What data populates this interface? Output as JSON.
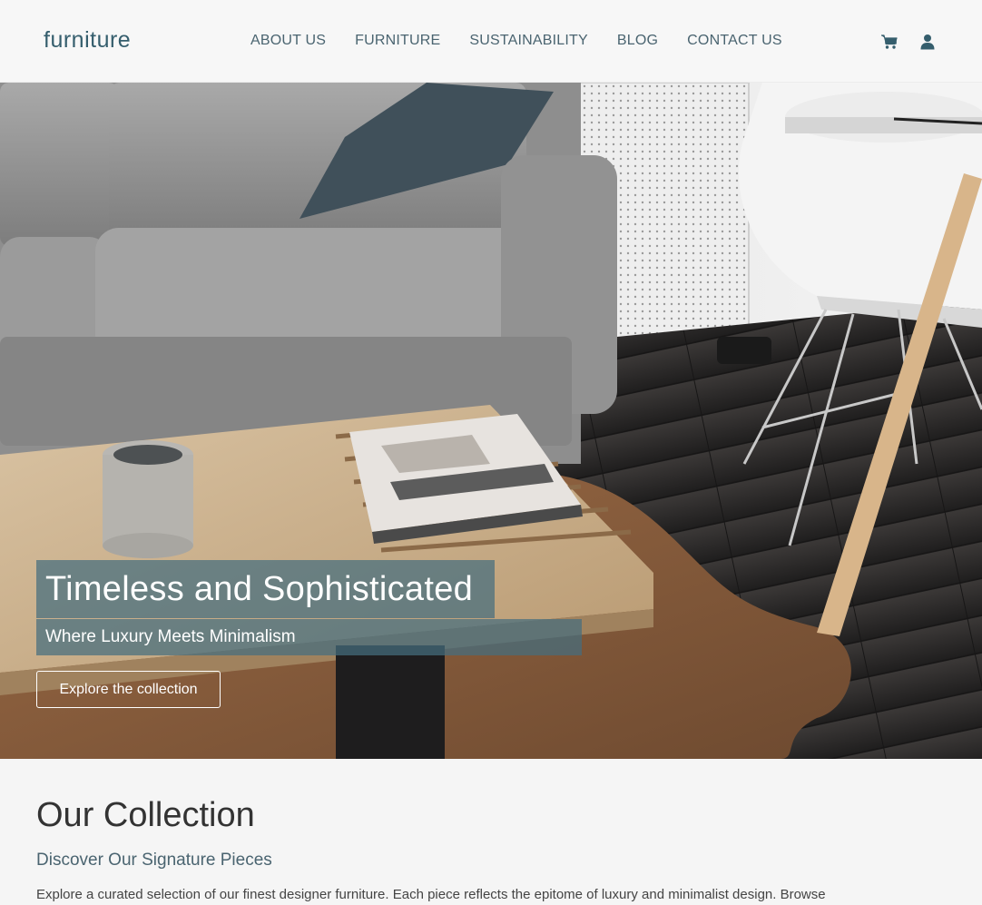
{
  "brand": {
    "logo_text": "furniture"
  },
  "nav": {
    "items": [
      {
        "label": "ABOUT US"
      },
      {
        "label": "FURNITURE"
      },
      {
        "label": "SUSTAINABILITY"
      },
      {
        "label": "BLOG"
      },
      {
        "label": "CONTACT US"
      }
    ]
  },
  "header_icons": {
    "cart": "cart-icon",
    "account": "user-icon"
  },
  "hero": {
    "title": "Timeless and Sophisticated",
    "subtitle": "Where Luxury Meets Minimalism",
    "cta_label": "Explore the collection",
    "overlay_color": "#456e7e"
  },
  "collection": {
    "title": "Our Collection",
    "subtitle": "Discover Our Signature Pieces",
    "description": "Explore a curated selection of our finest designer furniture. Each piece reflects the epitome of luxury and minimalist design. Browse"
  },
  "colors": {
    "accent": "#355e6d",
    "nav_text": "#4a6470",
    "background": "#f5f5f5"
  }
}
